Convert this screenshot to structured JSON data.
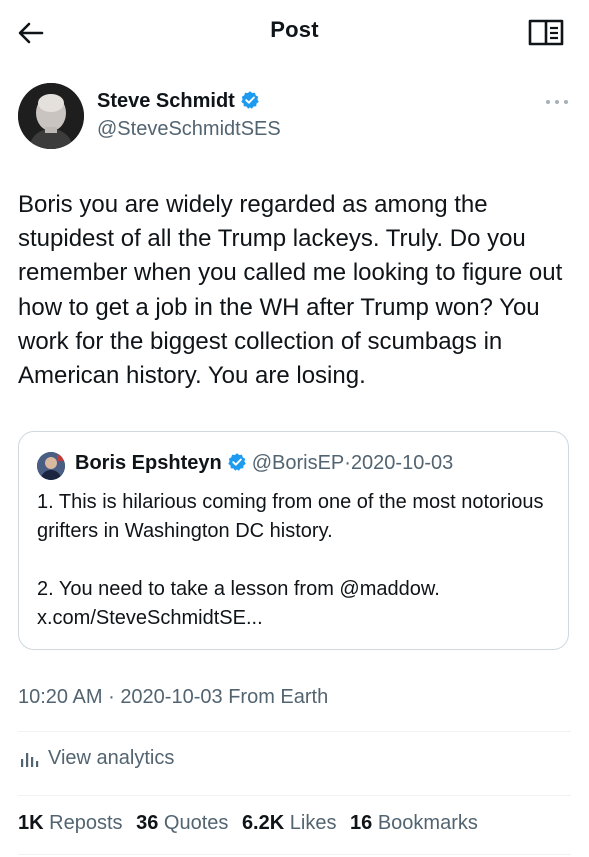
{
  "header": {
    "title": "Post",
    "back_icon": "arrow-left-icon",
    "reader_icon": "open-book-icon"
  },
  "tweet": {
    "author_name": "Steve Schmidt",
    "author_handle": "@SteveSchmidtSES",
    "verified_icon": "verified-badge-icon",
    "more_icon": "more-horizontal-icon",
    "text": "Boris you are widely regarded as among the stupidest of all the Trump lackeys. Truly. Do you remember when you called me looking to figure out how to get a job in the WH after Trump won? You work for the biggest collection of scumbags in American history. You are losing.",
    "time": "10:20 AM",
    "separator": "·",
    "date": "2020-10-03",
    "source": "From Earth"
  },
  "quote": {
    "author_name": "Boris Epshteyn",
    "author_handle": "@BorisEP",
    "separator": "·",
    "date": "2020-10-03",
    "paragraph1": "1. This is hilarious coming from one of the most notorious grifters in Washington DC history.",
    "paragraph2": "2. You need to take a lesson from @maddow. x.com/SteveSchmidtSE..."
  },
  "analytics": {
    "label": "View analytics",
    "icon": "bar-chart-icon"
  },
  "stats": {
    "reposts_count": "1K",
    "reposts_label": "Reposts",
    "quotes_count": "36",
    "quotes_label": "Quotes",
    "likes_count": "6.2K",
    "likes_label": "Likes",
    "bookmarks_count": "16",
    "bookmarks_label": "Bookmarks"
  },
  "colors": {
    "text": "#0f1419",
    "secondary": "#536471",
    "verified": "#1d9bf0",
    "border": "#cfd9de",
    "divider": "#eff3f4"
  }
}
